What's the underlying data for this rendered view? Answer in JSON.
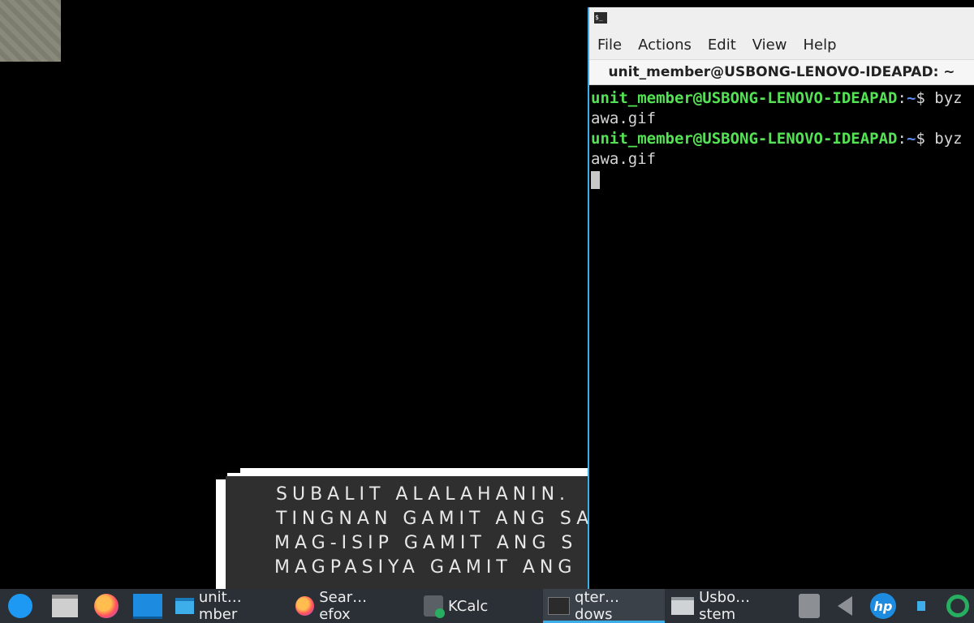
{
  "terminal": {
    "menu": [
      "File",
      "Actions",
      "Edit",
      "View",
      "Help"
    ],
    "tab_title": "unit_member@USBONG-LENOVO-IDEAPAD: ~",
    "lines": [
      {
        "user": "unit_member@USBONG-LENOVO-IDEAPAD",
        "sep": ":",
        "path": "~",
        "cmd": "$ byz"
      },
      {
        "output": "awa.gif"
      },
      {
        "user": "unit_member@USBONG-LENOVO-IDEAPAD",
        "sep": ":",
        "path": "~",
        "cmd": "$ byz"
      },
      {
        "output": "awa.gif"
      }
    ]
  },
  "game": {
    "lines": [
      "SUBALIT ALALAHANIN.",
      "TINGNAN GAMIT ANG SA",
      "MAG-ISIP GAMIT ANG S",
      "MAGPASIYA GAMIT ANG"
    ]
  },
  "taskbar": {
    "tasks": [
      {
        "label": "unit…mber",
        "icon": "folder-icon"
      },
      {
        "label": "Sear…efox",
        "icon": "firefox-icon"
      },
      {
        "label": "KCalc",
        "icon": "calculator-icon"
      },
      {
        "label": "qter…dows",
        "icon": "terminal-icon",
        "active": true
      },
      {
        "label": "Usbo…stem",
        "icon": "window-icon"
      }
    ],
    "hp_label": "hp"
  }
}
